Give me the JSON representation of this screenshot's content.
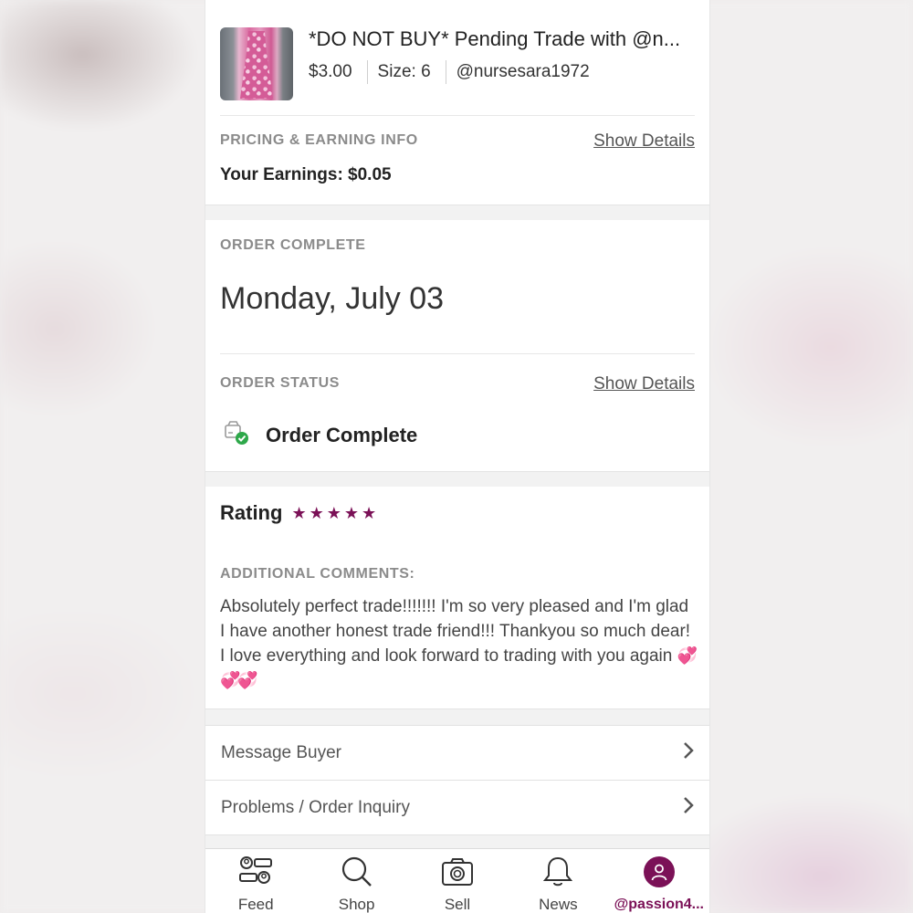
{
  "listing": {
    "title": "*DO NOT BUY* Pending Trade with @n...",
    "price": "$3.00",
    "size": "Size: 6",
    "seller": "@nursesara1972"
  },
  "pricing": {
    "heading": "PRICING & EARNING INFO",
    "show_details": "Show Details",
    "earnings": "Your Earnings: $0.05"
  },
  "order": {
    "heading": "ORDER COMPLETE",
    "date": "Monday, July 03",
    "status_heading": "ORDER STATUS",
    "show_details": "Show Details",
    "status": "Order Complete",
    "status_icon": "package-check-icon"
  },
  "rating": {
    "label": "Rating",
    "stars": 5,
    "star_color": "#7b1157",
    "comments_heading": "ADDITIONAL COMMENTS:",
    "comment": "Absolutely perfect trade!!!!!!! I'm so very pleased and I'm glad I have another honest trade friend!!! Thankyou so much dear! I love everything and look forward to trading with you again",
    "emoji": "💞💞💞"
  },
  "actions": {
    "message_buyer": "Message Buyer",
    "order_inquiry": "Problems / Order Inquiry"
  },
  "tabbar": {
    "feed": "Feed",
    "shop": "Shop",
    "sell": "Sell",
    "news": "News",
    "profile": "@passion4..."
  },
  "colors": {
    "accent": "#7b1157",
    "status_green": "#2ea84a"
  }
}
